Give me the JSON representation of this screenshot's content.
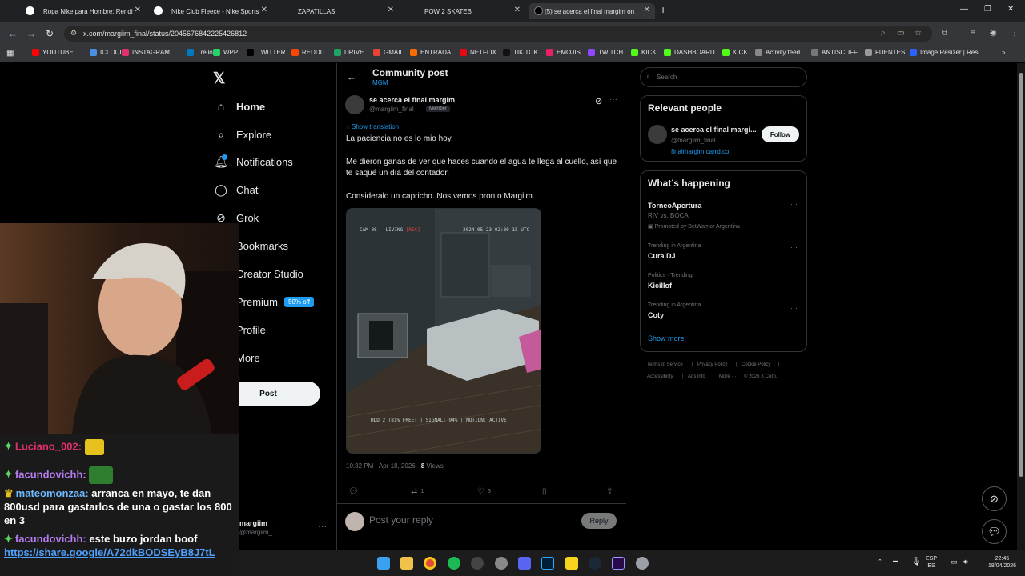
{
  "browser": {
    "tabs": [
      {
        "label": "Ropa Nike para Hombre: Rendi",
        "active": false
      },
      {
        "label": "Nike Club Fleece - Nike Sports",
        "active": false
      },
      {
        "label": "ZAPATILLAS",
        "active": false
      },
      {
        "label": "POW 2 SKATEB",
        "active": false
      },
      {
        "label": "(5) se acerca el final margim on",
        "active": true
      }
    ],
    "new_tab": "+",
    "url": "x.com/margiim_final/status/2045676842225426812",
    "bookmarks": [
      "YOUTUBE",
      "ICLOUD",
      "INSTAGRAM",
      "Trello",
      "WPP",
      "TWITTER",
      "REDDIT",
      "DRIVE",
      "GMAIL",
      "ENTRADA",
      "NETFLIX",
      "TIK TOK",
      "EMOJIS",
      "TWITCH",
      "KICK",
      "DASHBOARD",
      "KICK",
      "Activity feed",
      "ANTISCUFF",
      "FUENTES",
      "Image Resizer | Resi..."
    ],
    "bookmark_colors": [
      "#ff0000",
      "#4a90e2",
      "#e1306c",
      "#0079bf",
      "#25d366",
      "#000000",
      "#ff4500",
      "#1fa463",
      "#ea4335",
      "#ff6d00",
      "#e50914",
      "#111111",
      "#e91e63",
      "#9146ff",
      "#53fc18",
      "#53fc18",
      "#53fc18",
      "#888888",
      "#777777",
      "#999999",
      "#2962ff"
    ]
  },
  "sidebar": {
    "items": [
      {
        "label": "Home",
        "icon": "home-icon"
      },
      {
        "label": "Explore",
        "icon": "search-icon"
      },
      {
        "label": "Notifications",
        "icon": "bell-icon"
      },
      {
        "label": "Chat",
        "icon": "chat-icon"
      },
      {
        "label": "Grok",
        "icon": "grok-icon"
      },
      {
        "label": "Bookmarks",
        "icon": "bookmark-icon"
      },
      {
        "label": "Creator Studio",
        "icon": "creator-studio-icon"
      },
      {
        "label": "Premium",
        "icon": "premium-icon"
      },
      {
        "label": "Profile",
        "icon": "profile-icon"
      },
      {
        "label": "More",
        "icon": "more-icon"
      }
    ],
    "premium_badge": "50% off",
    "post_button": "Post",
    "account": {
      "name": "margiim",
      "handle": "@margiim_"
    }
  },
  "post": {
    "header_title": "Community post",
    "header_sub": "MGM",
    "author": "se acerca el final margim",
    "handle": "@margiim_final",
    "badge": "Member",
    "show_translation": "Show translation",
    "paragraphs": [
      "La paciencia no es lo mio hoy.",
      "Me dieron ganas de ver que haces cuando el agua te llega al cuello, así que te saqué un día del contador.",
      "Consideralo un capricho. Nos vemos pronto Margiim."
    ],
    "media": {
      "cam_label": "CAM 08 - LIVING",
      "rec": "[REC]",
      "timestamp": "2024-05-23 02:30 15 UTC",
      "status_line": "HDD 2 [81% FREE] | SIGNAL: 94% | MOTION: ACTIVE"
    },
    "time": "10:32 PM · Apr 18, 2026 · ",
    "views_count": "8",
    "views_label": " Views",
    "actions": {
      "reposts": "1",
      "likes": "3"
    },
    "reply_placeholder": "Post your reply",
    "reply_button": "Reply"
  },
  "right": {
    "search_placeholder": "Search",
    "relevant_title": "Relevant people",
    "relevant": {
      "name": "se acerca el final margi...",
      "handle": "@margiim_final",
      "link": "finalmargim.carrd.co",
      "follow": "Follow"
    },
    "happening_title": "What’s happening",
    "trends": [
      {
        "context": "",
        "name": "TorneoApertura",
        "sub": "RIV vs. BOCA",
        "promo": "Promoted by BetWarrior Argentina"
      },
      {
        "context": "Trending in Argentina",
        "name": "Cura DJ",
        "sub": "",
        "promo": ""
      },
      {
        "context": "Politics · Trending",
        "name": "Kicillof",
        "sub": "",
        "promo": ""
      },
      {
        "context": "Trending in Argentina",
        "name": "Coty",
        "sub": "",
        "promo": ""
      }
    ],
    "show_more": "Show more",
    "footer": [
      "Terms of Service",
      "|",
      "Privacy Policy",
      "|",
      "Cookie Policy",
      "|",
      "Accessibility",
      "|",
      "Ads info",
      "|",
      "More ···",
      "© 2026 X Corp."
    ]
  },
  "chat": [
    {
      "user": "Luciano_002:",
      "text": "",
      "color": "red"
    },
    {
      "user": "facundovichh:",
      "text": "",
      "color": "purple"
    },
    {
      "user": "mateomonzaa:",
      "text": " arranca en mayo, te dan 800usd para gastarlos de una o gastar los 800 en 3",
      "color": "blue"
    },
    {
      "user": "facundovichh:",
      "text": " este buzo jordan boof",
      "color": "purple",
      "link": "https://share.google/A72dkBODSEyB8J7tL"
    }
  ],
  "tray": {
    "lang1": "ESP",
    "lang2": "ES",
    "time": "22:45",
    "date": "18/04/2026"
  }
}
